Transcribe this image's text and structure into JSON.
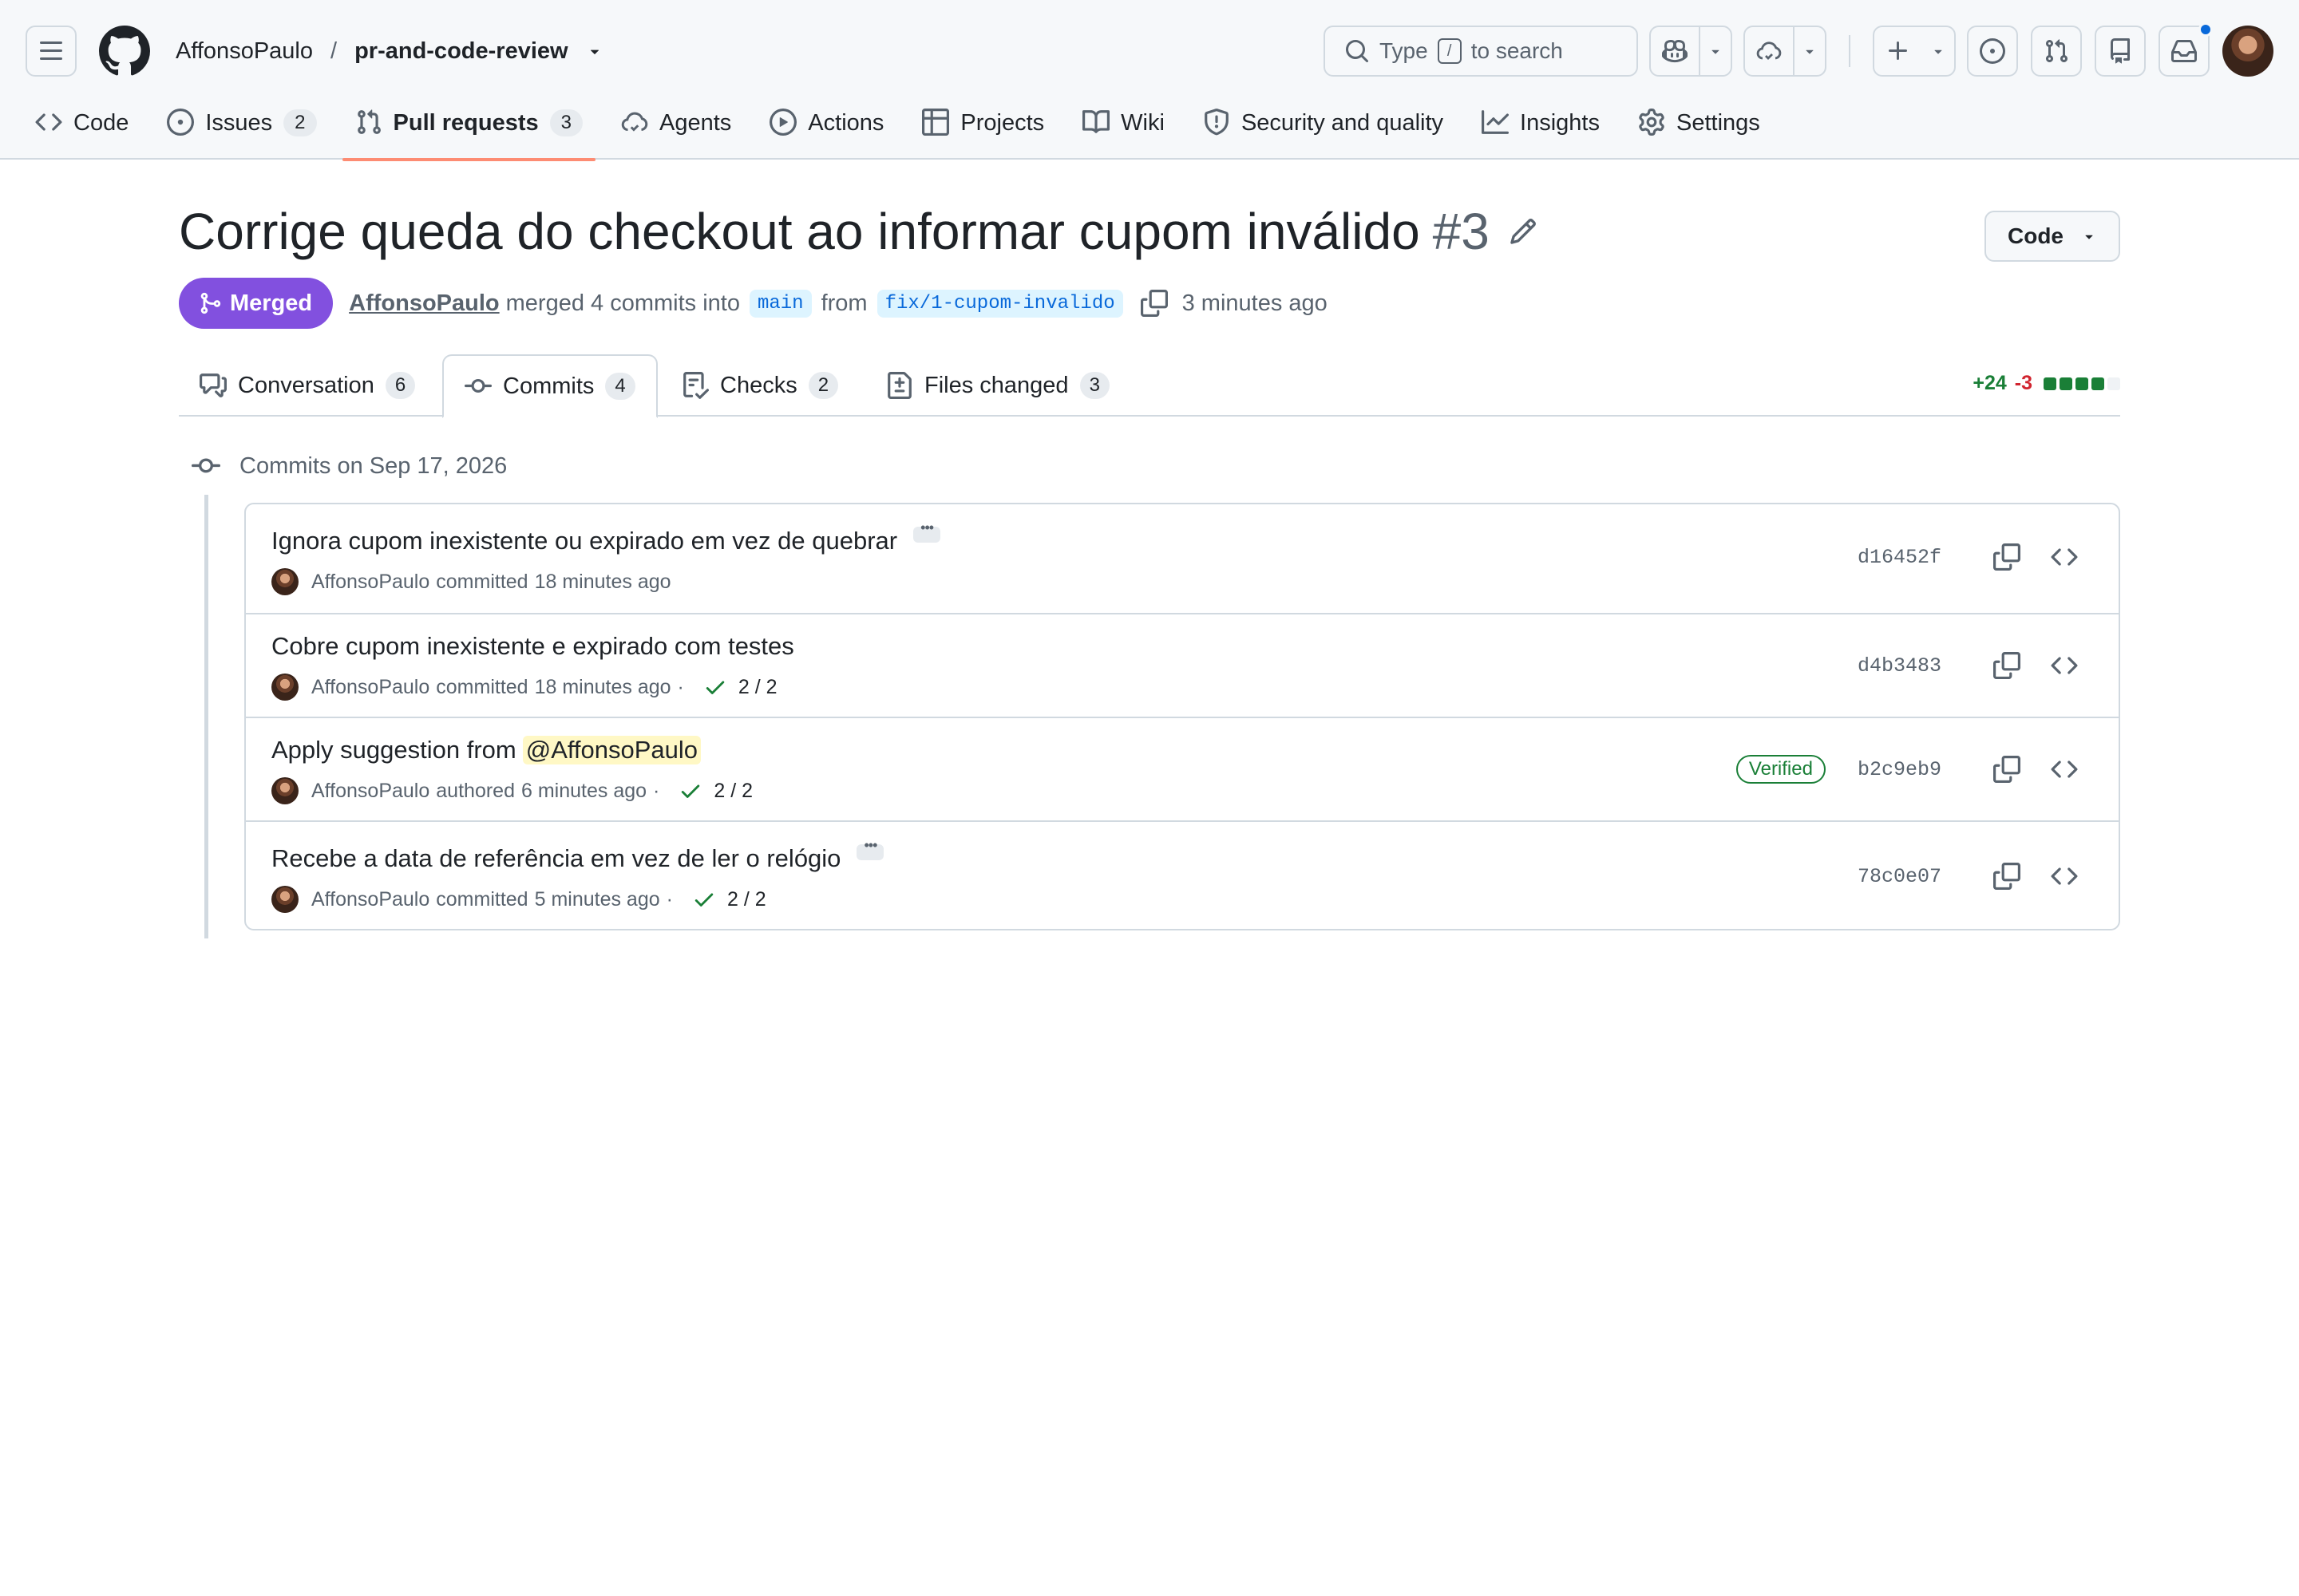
{
  "header": {
    "owner": "AffonsoPaulo",
    "separator": "/",
    "repo": "pr-and-code-review",
    "search_prefix": "Type",
    "search_key": "/",
    "search_suffix": "to search"
  },
  "repo_nav": [
    {
      "label": "Code",
      "icon": "code-icon"
    },
    {
      "label": "Issues",
      "count": "2",
      "icon": "issue-opened-icon"
    },
    {
      "label": "Pull requests",
      "count": "3",
      "icon": "git-pull-request-icon",
      "active": true
    },
    {
      "label": "Agents",
      "icon": "agent-icon"
    },
    {
      "label": "Actions",
      "icon": "play-icon"
    },
    {
      "label": "Projects",
      "icon": "table-icon"
    },
    {
      "label": "Wiki",
      "icon": "book-icon"
    },
    {
      "label": "Security and quality",
      "icon": "shield-icon"
    },
    {
      "label": "Insights",
      "icon": "graph-icon"
    },
    {
      "label": "Settings",
      "icon": "gear-icon"
    }
  ],
  "pr": {
    "title": "Corrige queda do checkout ao informar cupom inválido",
    "number": "#3",
    "state": "Merged",
    "author": "AffonsoPaulo",
    "merged_text": "merged 4 commits into",
    "base": "main",
    "from_text": "from",
    "head": "fix/1-cupom-invalido",
    "time": "3 minutes ago",
    "code_button": "Code"
  },
  "tabs": [
    {
      "label": "Conversation",
      "count": "6",
      "icon": "comment-discussion-icon"
    },
    {
      "label": "Commits",
      "count": "4",
      "icon": "git-commit-icon",
      "active": true
    },
    {
      "label": "Checks",
      "count": "2",
      "icon": "checklist-icon"
    },
    {
      "label": "Files changed",
      "count": "3",
      "icon": "file-diff-icon"
    }
  ],
  "diffstat": {
    "additions": "+24",
    "deletions": "-3",
    "blocks": [
      "#1a7f37",
      "#1a7f37",
      "#1a7f37",
      "#1a7f37",
      "#eff2f5"
    ]
  },
  "commits_group": {
    "heading": "Commits on Sep 17, 2026"
  },
  "commits": [
    {
      "message": "Ignora cupom inexistente ou expirado em vez de quebrar",
      "author": "AffonsoPaulo",
      "action": "committed",
      "time": "18 minutes ago",
      "sha": "d16452f",
      "has_ellipsis": true
    },
    {
      "message": "Cobre cupom inexistente e expirado com testes",
      "author": "AffonsoPaulo",
      "action": "committed",
      "time": "18 minutes ago",
      "checks": "2 / 2",
      "sha": "d4b3483"
    },
    {
      "message_prefix": "Apply suggestion from",
      "mention": "@AffonsoPaulo",
      "author": "AffonsoPaulo",
      "action": "authored",
      "time": "6 minutes ago",
      "checks": "2 / 2",
      "verified": "Verified",
      "sha": "b2c9eb9"
    },
    {
      "message": "Recebe a data de referência em vez de ler o relógio",
      "author": "AffonsoPaulo",
      "action": "committed",
      "time": "5 minutes ago",
      "checks": "2 / 2",
      "sha": "78c0e07",
      "has_ellipsis": true
    }
  ],
  "separator_dot": "·",
  "colors": {
    "accent": "#0969da",
    "merged": "#8250df",
    "success": "#1a7f37",
    "danger": "#d1242f",
    "tab_underline": "#fd8c73"
  }
}
